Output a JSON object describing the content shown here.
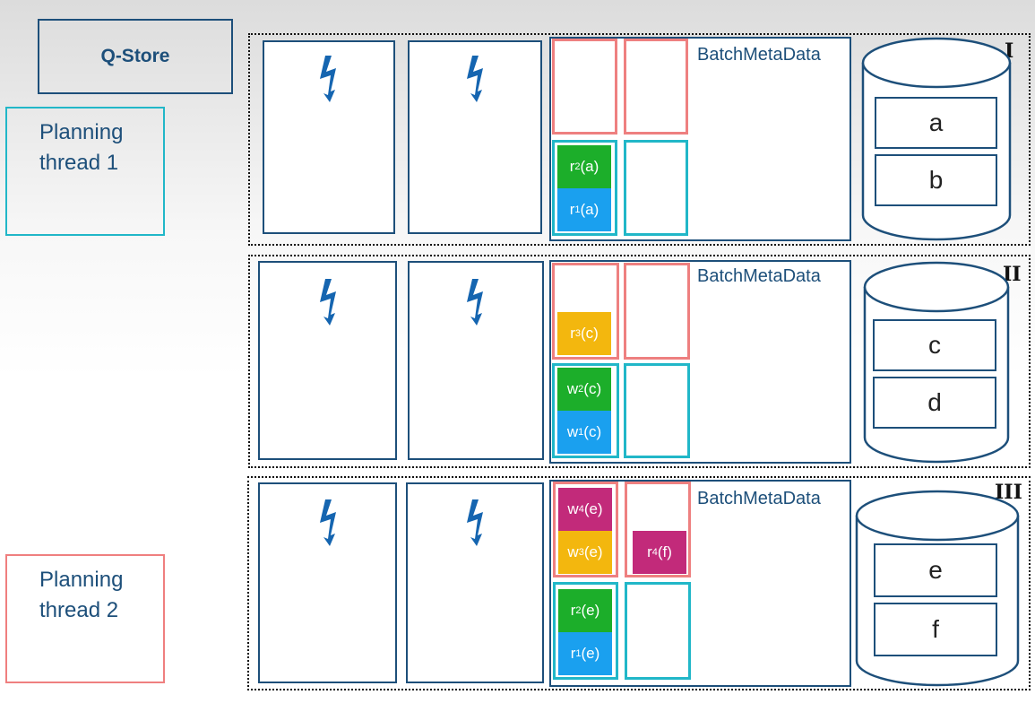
{
  "qstore": {
    "label": "Q-Store"
  },
  "planning_threads": [
    {
      "label": "Planning\nthread 1"
    },
    {
      "label": "Planning\nthread 2"
    }
  ],
  "meta_label": "BatchMetaData",
  "partitions": [
    {
      "roman": "I",
      "ops": {
        "red_left": [],
        "red_right": [],
        "cyan_left": [
          {
            "name": "r",
            "sub": "2",
            "arg": "(a)",
            "color": "#1cae2a"
          },
          {
            "name": "r",
            "sub": "1",
            "arg": "(a)",
            "color": "#1aa0ef"
          }
        ]
      },
      "records": [
        "a",
        "b"
      ]
    },
    {
      "roman": "II",
      "ops": {
        "red_left": [
          {
            "name": "r",
            "sub": "3",
            "arg": "(c)",
            "color": "#f3b70e"
          }
        ],
        "red_right": [],
        "cyan_left": [
          {
            "name": "w",
            "sub": "2",
            "arg": "(c)",
            "color": "#1cae2a"
          },
          {
            "name": "w",
            "sub": "1",
            "arg": "(c)",
            "color": "#1aa0ef"
          }
        ]
      },
      "records": [
        "c",
        "d"
      ]
    },
    {
      "roman": "III",
      "ops": {
        "red_left": [
          {
            "name": "w",
            "sub": "4",
            "arg": "(e)",
            "color": "#c22a7a"
          },
          {
            "name": "w",
            "sub": "3",
            "arg": "(e)",
            "color": "#f3b70e"
          }
        ],
        "red_right": [
          {
            "name": "r",
            "sub": "4",
            "arg": "(f)",
            "color": "#c22a7a"
          }
        ],
        "cyan_left": [
          {
            "name": "r",
            "sub": "2",
            "arg": "(e)",
            "color": "#1cae2a"
          },
          {
            "name": "r",
            "sub": "1",
            "arg": "(e)",
            "color": "#1aa0ef"
          }
        ]
      },
      "records": [
        "e",
        "f"
      ]
    }
  ],
  "colors": {
    "navy": "#1d4f7a",
    "bolt": "#1565b0",
    "cyan": "#21b7c8",
    "red": "#ee8080"
  }
}
